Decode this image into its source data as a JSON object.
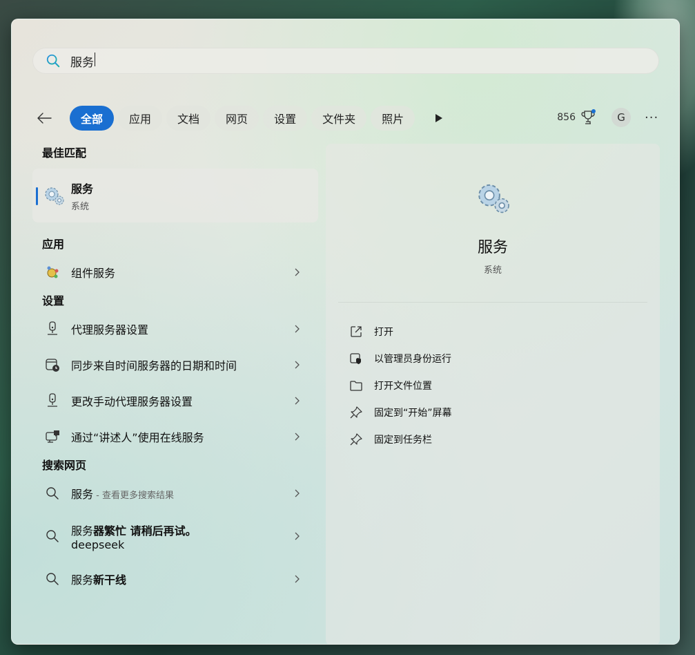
{
  "search": {
    "value": "服务"
  },
  "filters": {
    "tabs": [
      "全部",
      "应用",
      "文档",
      "网页",
      "设置",
      "文件夹",
      "照片"
    ],
    "points": "856",
    "avatar_letter": "G",
    "more": "···"
  },
  "best_match": {
    "section": "最佳匹配",
    "title": "服务",
    "subtitle": "系统"
  },
  "apps": {
    "section": "应用",
    "items": [
      {
        "label": "组件服务"
      }
    ]
  },
  "settings": {
    "section": "设置",
    "items": [
      {
        "label": "代理服务器设置"
      },
      {
        "label": "同步来自时间服务器的日期和时间"
      },
      {
        "label": "更改手动代理服务器设置"
      },
      {
        "label": "通过“讲述人”使用在线服务"
      }
    ]
  },
  "web": {
    "section": "搜索网页",
    "items": [
      {
        "prefix": "服务",
        "suffix": " - 查看更多搜索结果"
      },
      {
        "prefix": "服务",
        "bold": "器繁忙 请稍后再试。",
        "line2": "deepseek"
      },
      {
        "prefix": "服务",
        "bold": "新干线"
      }
    ]
  },
  "detail": {
    "title": "服务",
    "subtitle": "系统",
    "actions": [
      "打开",
      "以管理员身份运行",
      "打开文件位置",
      "固定到“开始”屏幕",
      "固定到任务栏"
    ]
  },
  "colors": {
    "accent": "#1a6fd1"
  }
}
